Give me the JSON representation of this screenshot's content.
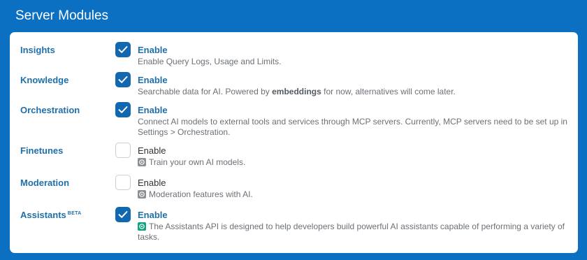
{
  "header": {
    "title": "Server Modules"
  },
  "modules": [
    {
      "label": "Insights",
      "enabled": true,
      "enable_label": "Enable",
      "description": "Enable Query Logs, Usage and Limits."
    },
    {
      "label": "Knowledge",
      "enabled": true,
      "enable_label": "Enable",
      "description_before": "Searchable data for AI. Powered by ",
      "description_bold": "embeddings",
      "description_after": " for now, alternatives will come later."
    },
    {
      "label": "Orchestration",
      "enabled": true,
      "enable_label": "Enable",
      "description": "Connect AI models to external tools and services through MCP servers. Currently, MCP servers need to be set up in Settings > Orchestration."
    },
    {
      "label": "Finetunes",
      "enabled": false,
      "enable_label": "Enable",
      "icon": "openai-grey-icon",
      "description": "Train your own AI models."
    },
    {
      "label": "Moderation",
      "enabled": false,
      "enable_label": "Enable",
      "icon": "openai-grey-icon",
      "description": "Moderation features with AI."
    },
    {
      "label": "Assistants",
      "badge": "BETA",
      "enabled": true,
      "enable_label": "Enable",
      "icon": "openai-green-icon",
      "description": "The Assistants API is designed to help developers build powerful AI assistants capable of performing a variety of tasks."
    }
  ],
  "colors": {
    "frame_blue": "#0b6fc2",
    "checkbox_blue": "#1167b0",
    "label_blue": "#1f6fa8",
    "openai_green": "#10a37f",
    "openai_grey": "#8c8f93"
  }
}
